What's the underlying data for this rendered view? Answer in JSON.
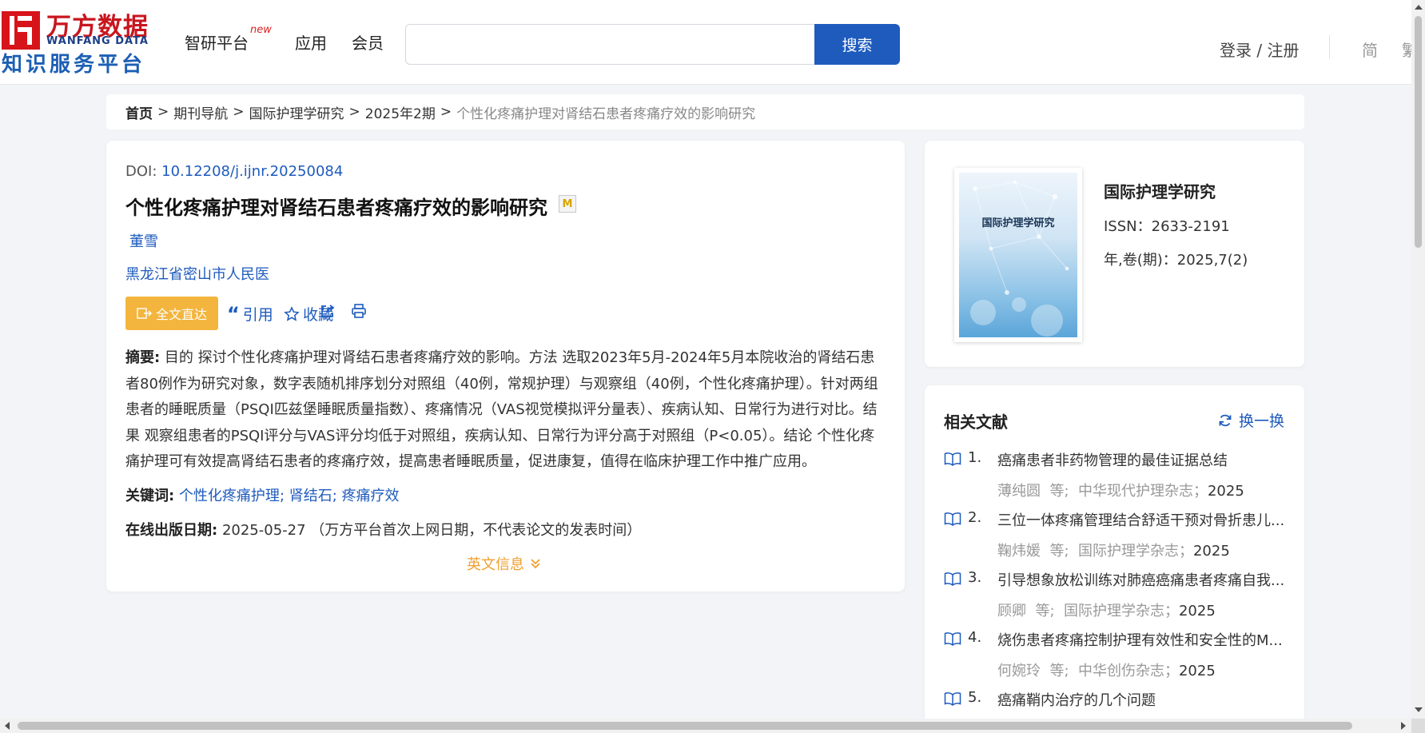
{
  "header": {
    "logo_cn": "万方数据",
    "logo_en": "WANFANG DATA",
    "logo_sub": "知识服务平台",
    "nav": {
      "zhiyan": "智研平台",
      "zhiyan_badge": "new",
      "apps": "应用",
      "member": "会员"
    },
    "search": {
      "placeholder": "",
      "button": "搜索"
    },
    "login": "登录 / 注册",
    "lang_simplified": "简",
    "lang_traditional": "繁"
  },
  "breadcrumb": {
    "items": [
      "首页",
      "期刊导航",
      "国际护理学研究",
      "2025年2期"
    ],
    "current": "个性化疼痛护理对肾结石患者疼痛疗效的影响研究",
    "separator": ">"
  },
  "article": {
    "doi_label": "DOI: ",
    "doi": "10.12208/j.ijnr.20250084",
    "title": "个性化疼痛护理对肾结石患者疼痛疗效的影响研究",
    "badge": "M",
    "author": "董雪",
    "organization": "黑龙江省密山市人民医",
    "actions": {
      "fulltext": "全文直达",
      "cite": "引用",
      "favorite": "收藏"
    },
    "abstract_label": "摘要:",
    "abstract": " 目的 探讨个性化疼痛护理对肾结石患者疼痛疗效的影响。方法 选取2023年5月-2024年5月本院收治的肾结石患者80例作为研究对象，数字表随机排序划分对照组（40例，常规护理）与观察组（40例，个性化疼痛护理）。针对两组患者的睡眠质量（PSQI匹兹堡睡眠质量指数）、疼痛情况（VAS视觉模拟评分量表）、疾病认知、日常行为进行对比。结果 观察组患者的PSQI评分与VAS评分均低于对照组，疾病认知、日常行为评分高于对照组（P<0.05）。结论 个性化疼痛护理可有效提高肾结石患者的疼痛疗效，提高患者睡眠质量，促进康复，值得在临床护理工作中推广应用。",
    "keywords_label": "关键词:",
    "keywords": [
      "个性化疼痛护理",
      "肾结石",
      "疼痛疗效"
    ],
    "keyword_sep": ";",
    "online_date_label": "在线出版日期:",
    "online_date": "2025-05-27",
    "online_date_note": "（万方平台首次上网日期，不代表论文的发表时间）",
    "english_info": "英文信息"
  },
  "journal": {
    "cover_title": "国际护理学研究",
    "name": "国际护理学研究",
    "issn_label": "ISSN：",
    "issn": "2633-2191",
    "volume_label": "年,卷(期)：",
    "volume": "2025,7(2)"
  },
  "related": {
    "title": "相关文献",
    "refresh": "换一换",
    "items": [
      {
        "num": "1.",
        "title": "癌痛患者非药物管理的最佳证据总结",
        "authors": "薄纯圆",
        "etal": "等;",
        "source": "中华现代护理杂志；",
        "year": "2025"
      },
      {
        "num": "2.",
        "title": "三位一体疼痛管理结合舒适干预对骨折患儿...",
        "authors": "鞠炜媛",
        "etal": "等;",
        "source": "国际护理学杂志；",
        "year": "2025"
      },
      {
        "num": "3.",
        "title": "引导想象放松训练对肺癌癌痛患者疼痛自我...",
        "authors": "顾卿",
        "etal": "等;",
        "source": "国际护理学杂志；",
        "year": "2025"
      },
      {
        "num": "4.",
        "title": "烧伤患者疼痛控制护理有效性和安全性的M...",
        "authors": "何婉玲",
        "etal": "等;",
        "source": "中华创伤杂志；",
        "year": "2025"
      },
      {
        "num": "5.",
        "title": "癌痛鞘内治疗的几个问题",
        "authors": "",
        "etal": "",
        "source": "",
        "year": ""
      }
    ]
  },
  "colors": {
    "brand_red": "#c8161e",
    "link_blue": "#1e5bbd",
    "accent_orange": "#f3b53d"
  }
}
